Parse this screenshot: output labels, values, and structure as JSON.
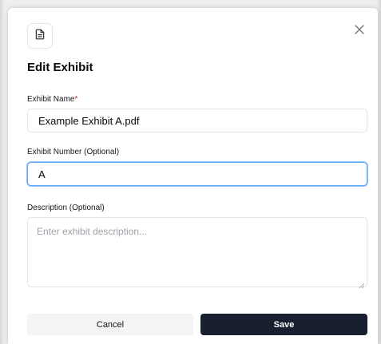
{
  "dialog": {
    "title": "Edit Exhibit",
    "icon": "file-text-icon",
    "close_icon": "close-icon"
  },
  "form": {
    "name": {
      "label": "Exhibit Name",
      "required_mark": "*",
      "value": "Example Exhibit A.pdf"
    },
    "number": {
      "label": "Exhibit Number (Optional)",
      "value": "A"
    },
    "description": {
      "label": "Description (Optional)",
      "placeholder": "Enter exhibit description...",
      "value": ""
    }
  },
  "actions": {
    "cancel_label": "Cancel",
    "save_label": "Save"
  },
  "colors": {
    "required": "#dc2626",
    "primary_button": "#18202f",
    "focus_ring": "#60a5fa"
  }
}
